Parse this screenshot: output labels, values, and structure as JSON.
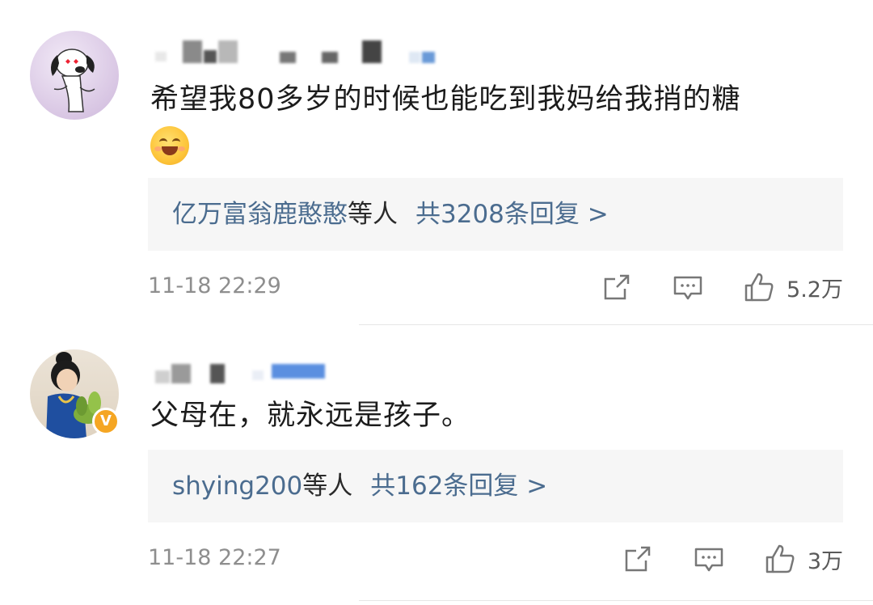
{
  "comments": [
    {
      "text": "希望我80多岁的时候也能吃到我妈给我捎的糖",
      "replies": {
        "people": "亿万富翁鹿憨憨",
        "suffix": "等人",
        "count": "共3208条回复 >"
      },
      "time": "11-18 22:29",
      "likes": "5.2万",
      "icons": [
        "share-icon",
        "reply-icon",
        "like-icon"
      ],
      "emoji": "hug-emoji"
    },
    {
      "text": "父母在，就永远是孩子。",
      "verified_badge": "V",
      "replies": {
        "people": "shying200",
        "suffix": "等人",
        "count": "共162条回复 >"
      },
      "time": "11-18 22:27",
      "likes": "3万",
      "icons": [
        "share-icon",
        "reply-icon",
        "like-icon"
      ]
    }
  ],
  "colors": {
    "link": "#4b6c8f",
    "reply_box_bg": "#f6f6f6",
    "meta_text": "#8e8e8e",
    "verified_badge": "#f5a623"
  }
}
